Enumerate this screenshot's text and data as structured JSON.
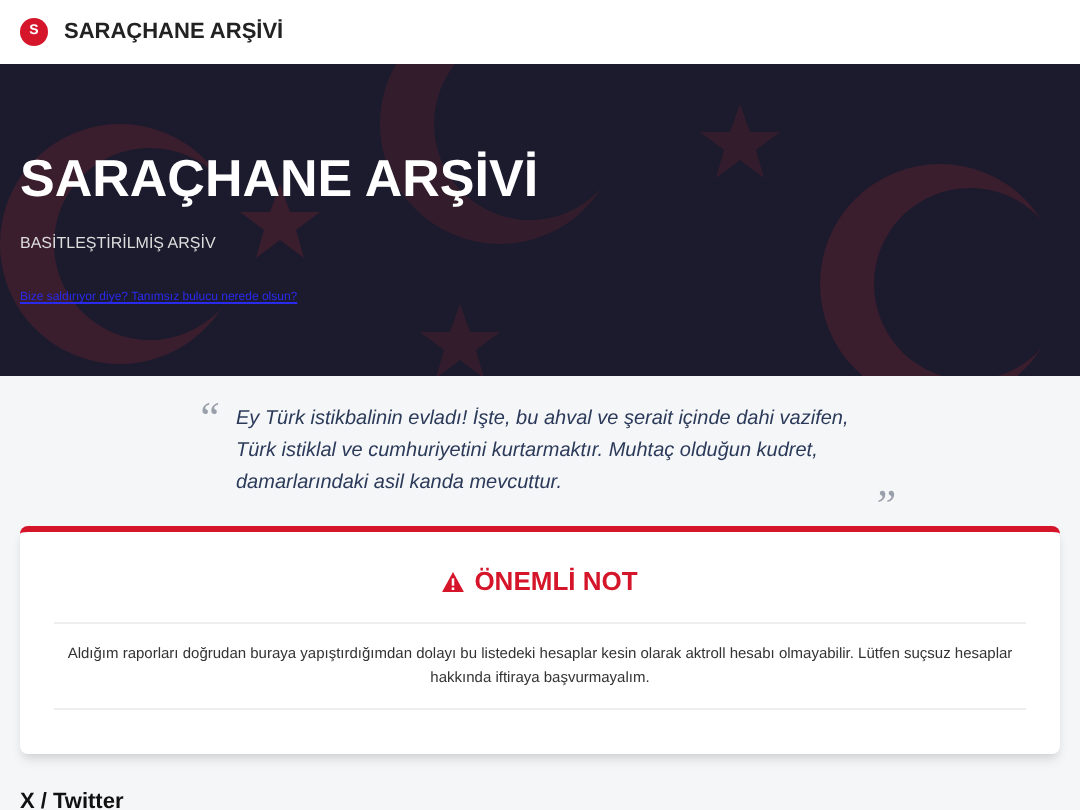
{
  "header": {
    "logo_letter": "S",
    "title": "SARAÇHANE ARŞİVİ"
  },
  "hero": {
    "title": "SARAÇHANE ARŞİVİ",
    "subtitle": "BASİTLEŞTİRİLMİŞ ARŞİV",
    "link": "Bize saldırıyor diye? Tanımsız bulucu nerede olsun?"
  },
  "quote": {
    "open_mark": "“",
    "close_mark": "”",
    "text": "Ey Türk istikbalinin evladı! İşte, bu ahval ve şerait içinde dahi vazifen, Türk istiklal ve cumhuriyetini kurtarmaktır. Muhtaç olduğun kudret, damarlarındaki asil kanda mevcuttur."
  },
  "notice": {
    "title": "ÖNEMLİ NOT",
    "text": "Aldığım raporları doğrudan buraya yapıştırdığımdan dolayı bu listedeki hesaplar kesin olarak aktroll hesabı olmayabilir. Lütfen suçsuz hesaplar hakkında iftiraya başvurmayalım."
  },
  "section": {
    "title": "X / Twitter"
  }
}
